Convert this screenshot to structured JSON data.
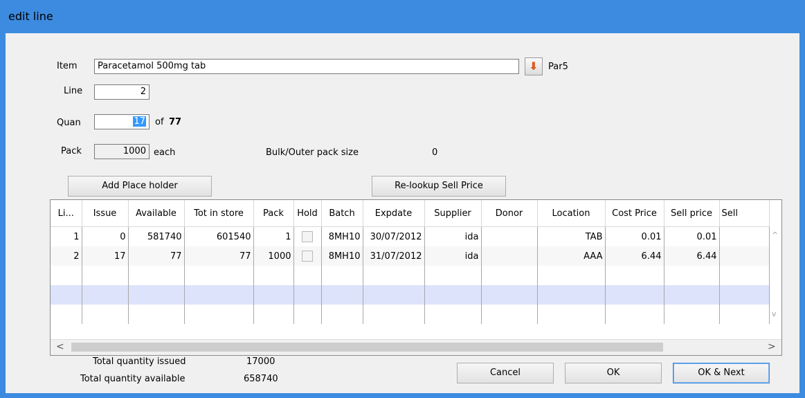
{
  "window": {
    "title": "edit line"
  },
  "form": {
    "item_label": "Item",
    "item_value": "Paracetamol 500mg tab",
    "item_code": "Par5",
    "line_label": "Line",
    "line_value": "2",
    "quan_label": "Quan",
    "quan_value": "17",
    "quan_of": "of",
    "quan_max": "77",
    "pack_label": "Pack",
    "pack_value": "1000",
    "pack_unit": "each",
    "bulk_label": "Bulk/Outer pack size",
    "bulk_value": "0"
  },
  "buttons": {
    "add_placeholder": "Add Place holder",
    "relookup": "Re-lookup Sell Price",
    "cancel": "Cancel",
    "ok": "OK",
    "ok_next": "OK & Next"
  },
  "icons": {
    "lookup": "arrow-down-icon",
    "lookup_glyph": "⬇"
  },
  "grid": {
    "columns": [
      "Li...",
      "Issue",
      "Available",
      "Tot in store",
      "Pack",
      "Hold",
      "Batch",
      "Expdate",
      "Supplier",
      "Donor",
      "Location",
      "Cost Price",
      "Sell price",
      "Sell"
    ],
    "rows": [
      [
        "1",
        "0",
        "581740",
        "601540",
        "1",
        "",
        "8MH10",
        "30/07/2012",
        "ida",
        "",
        "TAB",
        "0.01",
        "0.01",
        ""
      ],
      [
        "2",
        "17",
        "77",
        "77",
        "1000",
        "",
        "8MH10",
        "31/07/2012",
        "ida",
        "",
        "AAA",
        "6.44",
        "6.44",
        ""
      ]
    ]
  },
  "totals": {
    "issued_label": "Total quantity issued",
    "issued_value": "17000",
    "available_label": "Total quantity available",
    "available_value": "658740"
  },
  "colors": {
    "title_bar": "#3c8be0",
    "selected_row": "#dde3fb",
    "selection": "#3399ff"
  }
}
